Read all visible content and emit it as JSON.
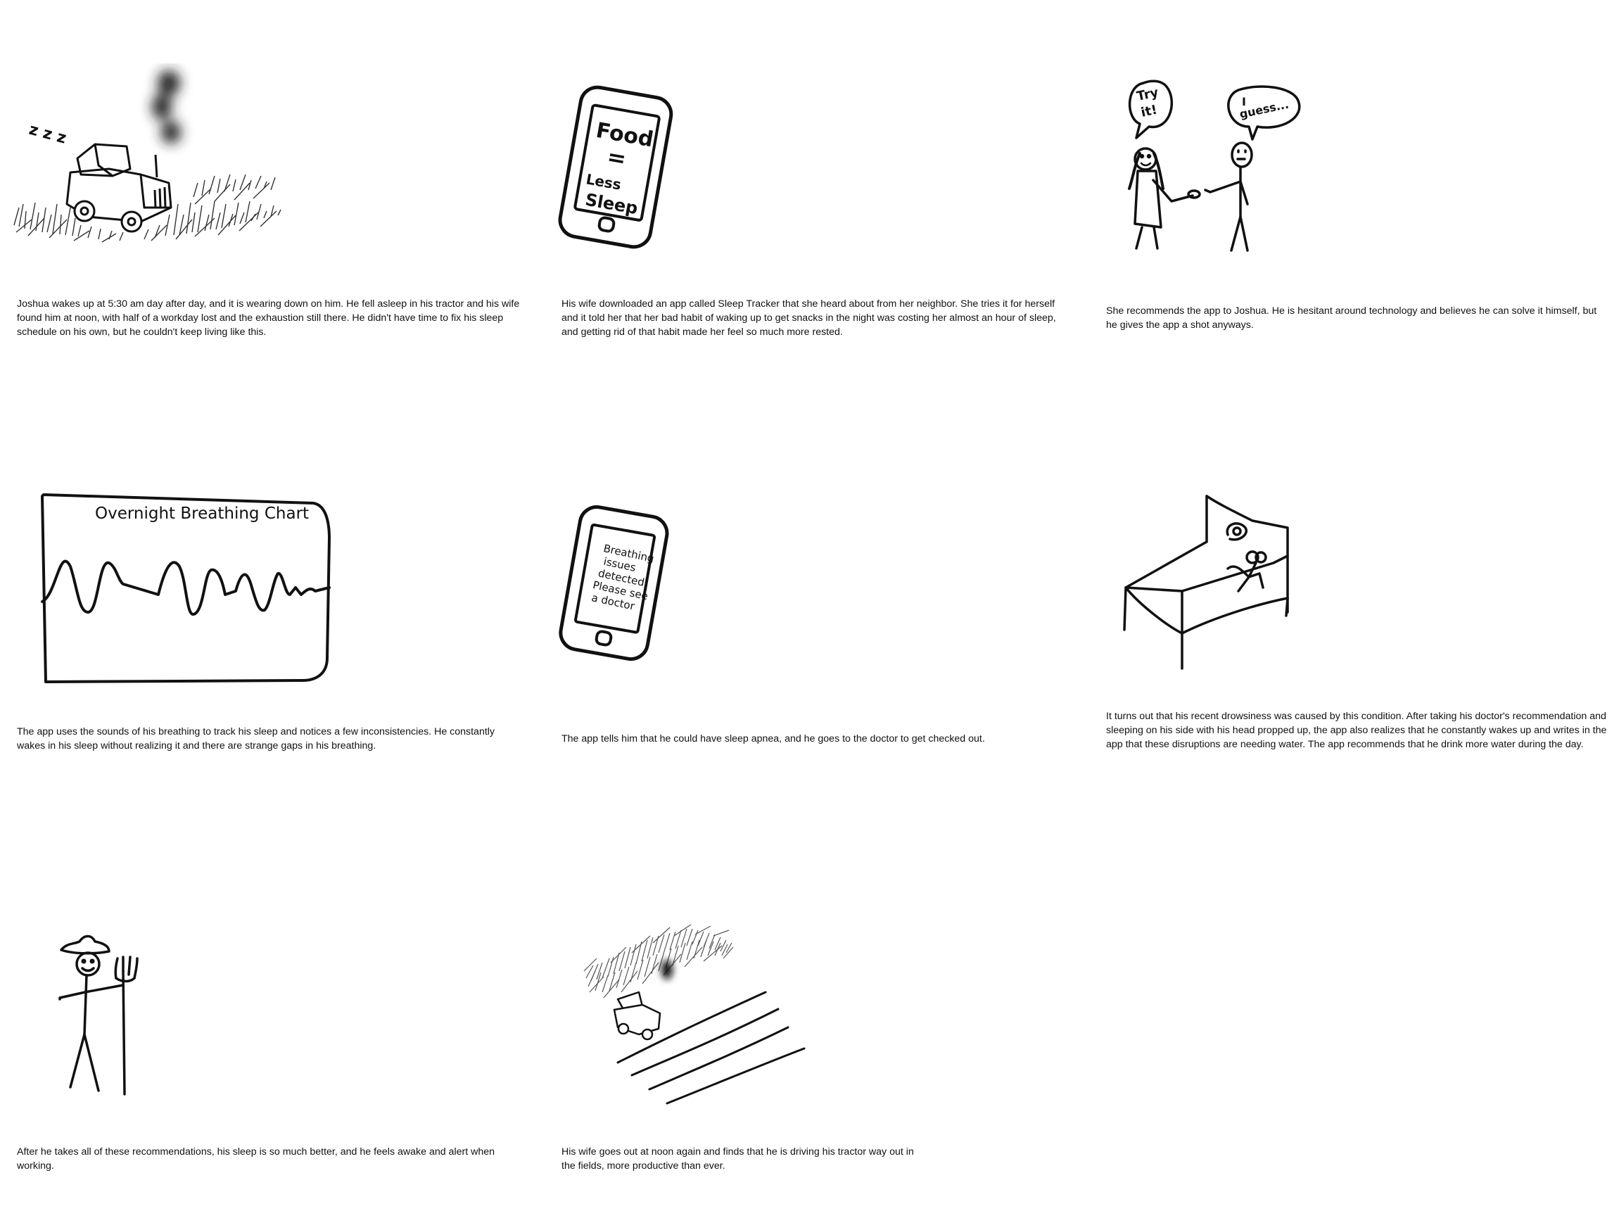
{
  "panels": [
    {
      "caption": "Joshua wakes up at 5:30 am day after day, and it is wearing down on him. He fell asleep in his tractor and his wife found him at noon, with half of a workday lost and the exhaustion still there. He didn't have time to fix his sleep schedule on his own, but he couldn't keep living like this.",
      "art": {
        "snore": "z z z"
      }
    },
    {
      "caption": "His wife downloaded an app called Sleep Tracker that she heard about from her neighbor. She tries it for herself and it told her that her bad habit of waking up to get snacks in the night was costing her almost an hour of sleep, and getting rid of that habit made her feel so much more rested.",
      "art": {
        "phone_line1": "Food",
        "phone_line2": "=",
        "phone_line3": "Less",
        "phone_line4": "Sleep"
      }
    },
    {
      "caption": "She recommends the app to Joshua. He is hesitant around technology and believes he can solve it himself, but he gives the app a shot anyways.",
      "art": {
        "bubble_wife_line1": "Try",
        "bubble_wife_line2": "it!",
        "bubble_joshua_line1": "I",
        "bubble_joshua_line2": "guess..."
      }
    },
    {
      "caption": "The app uses the sounds of his breathing to track his sleep and notices a few inconsistencies. He constantly wakes in his sleep without realizing it and there are strange gaps in his breathing.",
      "art": {
        "chart_title": "Overnight Breathing Chart"
      }
    },
    {
      "caption": "The app tells him that he could have sleep apnea, and he goes to the doctor to get checked out.",
      "art": {
        "screen_lines": [
          "Breathing",
          "issues",
          "detected:",
          "Please see",
          "a doctor"
        ]
      }
    },
    {
      "caption": "It turns out that his recent drowsiness was caused by this condition. After taking his doctor's recommendation and sleeping on his side with his head propped up, the app also realizes that he constantly wakes up and writes in the app that these disruptions are needing water. The app recommends that he drink more water during the day.",
      "art": {}
    },
    {
      "caption": "After he takes all of these recommendations, his sleep is so much better, and he feels awake and alert when working.",
      "art": {}
    },
    {
      "caption": "His wife goes out at noon again and finds that he is driving his tractor way out in the fields, more productive than ever.",
      "art": {}
    }
  ]
}
